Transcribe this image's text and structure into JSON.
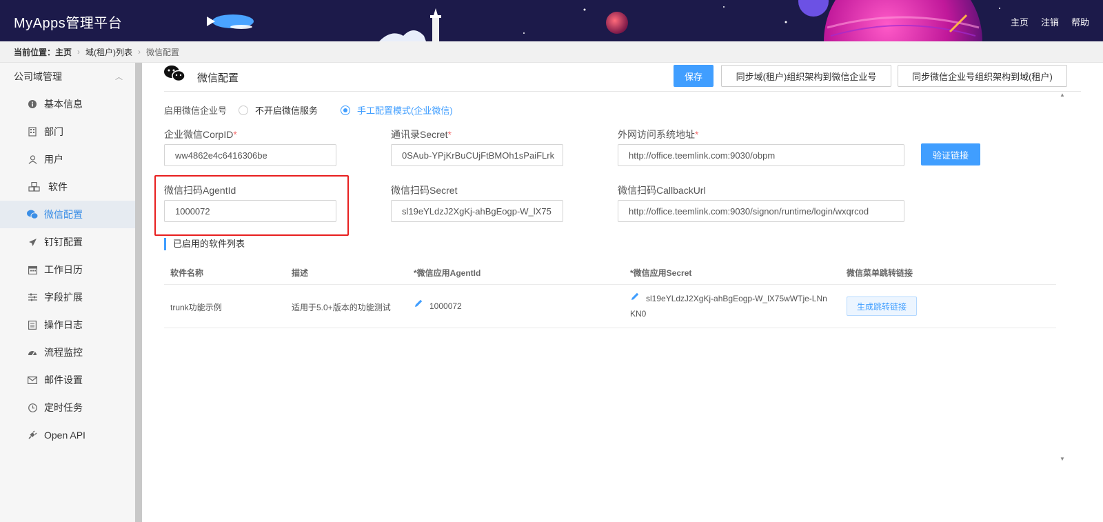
{
  "header": {
    "title": "MyApps管理平台",
    "nav": [
      "主页",
      "注销",
      "帮助"
    ]
  },
  "breadcrumb": {
    "current_label": "当前位置：",
    "items": [
      "主页",
      "域(租户)列表",
      "微信配置"
    ]
  },
  "sidebar": {
    "group": "公司域管理",
    "items": [
      {
        "label": "基本信息",
        "icon": "info-icon"
      },
      {
        "label": "部门",
        "icon": "building-icon"
      },
      {
        "label": "用户",
        "icon": "user-icon"
      },
      {
        "label": "软件",
        "icon": "cubes-icon"
      },
      {
        "label": "微信配置",
        "icon": "wechat-icon",
        "active": true
      },
      {
        "label": "钉钉配置",
        "icon": "plane-icon"
      },
      {
        "label": "工作日历",
        "icon": "calendar-icon"
      },
      {
        "label": "字段扩展",
        "icon": "sliders-icon"
      },
      {
        "label": "操作日志",
        "icon": "log-icon"
      },
      {
        "label": "流程监控",
        "icon": "dashboard-icon"
      },
      {
        "label": "邮件设置",
        "icon": "envelope-icon"
      },
      {
        "label": "定时任务",
        "icon": "clock-icon"
      },
      {
        "label": "Open API",
        "icon": "plug-icon"
      }
    ]
  },
  "panel": {
    "title": "微信配置",
    "buttons": {
      "save": "保存",
      "sync_to_wechat": "同步域(租户)组织架构到微信企业号",
      "sync_from_wechat": "同步微信企业号组织架构到域(租户)"
    }
  },
  "form": {
    "enable_label": "启用微信企业号",
    "radio_off": "不开启微信服务",
    "radio_manual": "手工配置模式(企业微信)",
    "corpid_label": "企业微信CorpID",
    "corpid_value": "ww4862e4c6416306be",
    "contacts_secret_label": "通讯录Secret",
    "contacts_secret_value": "0SAub-YPjKrBuCUjFtBMOh1sPaiFLrk",
    "external_url_label": "外网访问系统地址",
    "external_url_value": "http://office.teemlink.com:9030/obpm",
    "verify_button": "验证链接",
    "scan_agentid_label": "微信扫码AgentId",
    "scan_agentid_value": "1000072",
    "scan_secret_label": "微信扫码Secret",
    "scan_secret_value": "sl19eYLdzJ2XgKj-ahBgEogp-W_lX75",
    "callback_label": "微信扫码CallbackUrl",
    "callback_value": "http://office.teemlink.com:9030/signon/runtime/login/wxqrcod",
    "required_mark": "*"
  },
  "software_list": {
    "title": "已启用的软件列表",
    "columns": [
      "软件名称",
      "描述",
      "*微信应用AgentId",
      "*微信应用Secret",
      "微信菜单跳转链接"
    ],
    "rows": [
      {
        "name": "trunk功能示例",
        "description": "适用于5.0+版本的功能测试",
        "agent_id": "1000072",
        "secret_line1": "sl19eYLdzJ2XgKj-ahBgEogp-W_lX75wWTje-LNn",
        "secret_line2": "KN0",
        "action": "生成跳转链接"
      }
    ]
  },
  "colors": {
    "primary": "#409eff",
    "header_bg": "#1c1a4a",
    "highlight": "#e81e1e"
  }
}
